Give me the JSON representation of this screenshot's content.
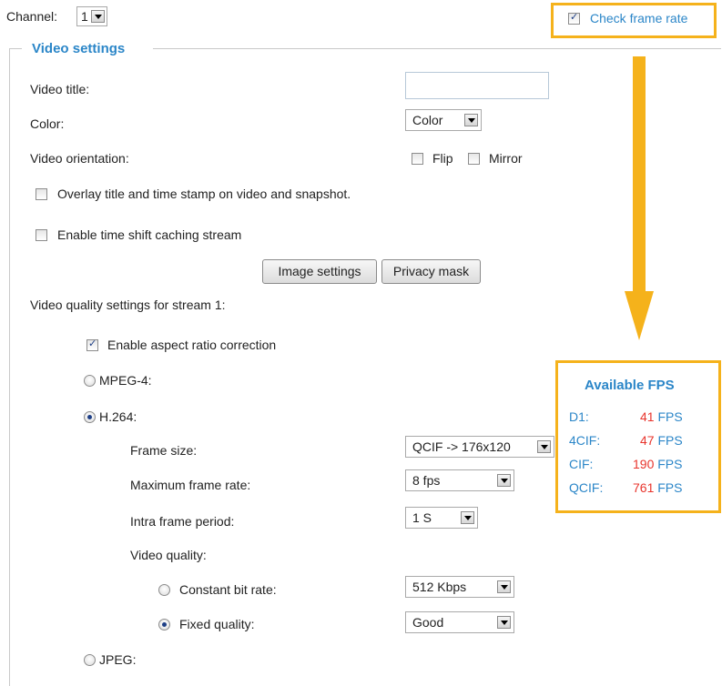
{
  "channel": {
    "label": "Channel:",
    "value": "1"
  },
  "check_frame_rate": {
    "label": "Check frame rate",
    "checked": true
  },
  "video_settings": {
    "legend": "Video settings",
    "video_title_label": "Video title:",
    "video_title_value": "",
    "color_label": "Color:",
    "color_value": "Color",
    "orientation_label": "Video orientation:",
    "flip_label": "Flip",
    "mirror_label": "Mirror",
    "overlay_label": "Overlay title and time stamp on video and snapshot.",
    "time_shift_label": "Enable time shift caching stream",
    "image_settings_button": "Image settings",
    "privacy_mask_button": "Privacy mask",
    "stream_quality_label": "Video quality settings for stream 1:",
    "aspect_ratio_label": "Enable aspect ratio correction",
    "mpeg4_label": "MPEG-4:",
    "h264_label": "H.264:",
    "frame_size_label": "Frame size:",
    "frame_size_value": "QCIF -> 176x120",
    "max_frame_rate_label": "Maximum frame rate:",
    "max_frame_rate_value": "8 fps",
    "intra_frame_label": "Intra frame period:",
    "intra_frame_value": "1 S",
    "video_quality_label": "Video quality:",
    "constant_bit_rate_label": "Constant bit rate:",
    "constant_bit_rate_value": "512 Kbps",
    "fixed_quality_label": "Fixed quality:",
    "fixed_quality_value": "Good",
    "jpeg_label": "JPEG:"
  },
  "available_fps": {
    "title": "Available FPS",
    "unit": "FPS",
    "rows": [
      {
        "name": "D1:",
        "value": "41"
      },
      {
        "name": "4CIF:",
        "value": "47"
      },
      {
        "name": "CIF:",
        "value": "190"
      },
      {
        "name": "QCIF:",
        "value": "761"
      }
    ]
  },
  "colors": {
    "accent": "#2b86c8",
    "highlight": "#f5b21b",
    "fps_value": "#e8352d"
  }
}
